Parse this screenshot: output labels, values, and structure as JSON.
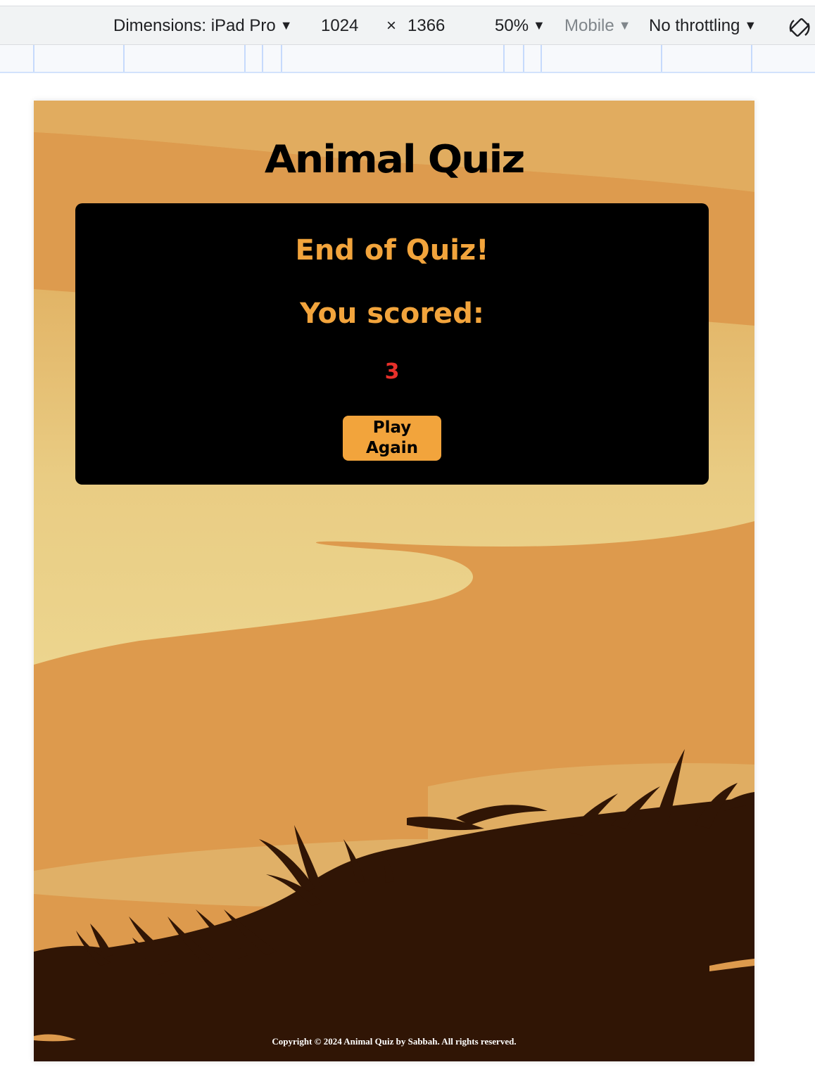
{
  "devtools": {
    "dimensions_label": "Dimensions: iPad Pro",
    "width": "1024",
    "times": "×",
    "height": "1366",
    "zoom": "50%",
    "device_type": "Mobile",
    "throttling": "No throttling",
    "dropdown_arrow": "▼"
  },
  "page": {
    "title": "Animal Quiz",
    "quiz": {
      "heading": "End of Quiz!",
      "score_label": "You scored:",
      "score": "3",
      "play_again_label": "Play Again"
    },
    "footer": {
      "copyright": "Copyright © 2024 Animal Quiz by Sabbah. All rights reserved."
    }
  },
  "colors": {
    "accent": "#f2a43c",
    "score": "#e8302a",
    "card": "#000000",
    "silhouette": "#301505",
    "sand_dark": "#dd9a4d",
    "sand_light": "#ebd38c"
  }
}
